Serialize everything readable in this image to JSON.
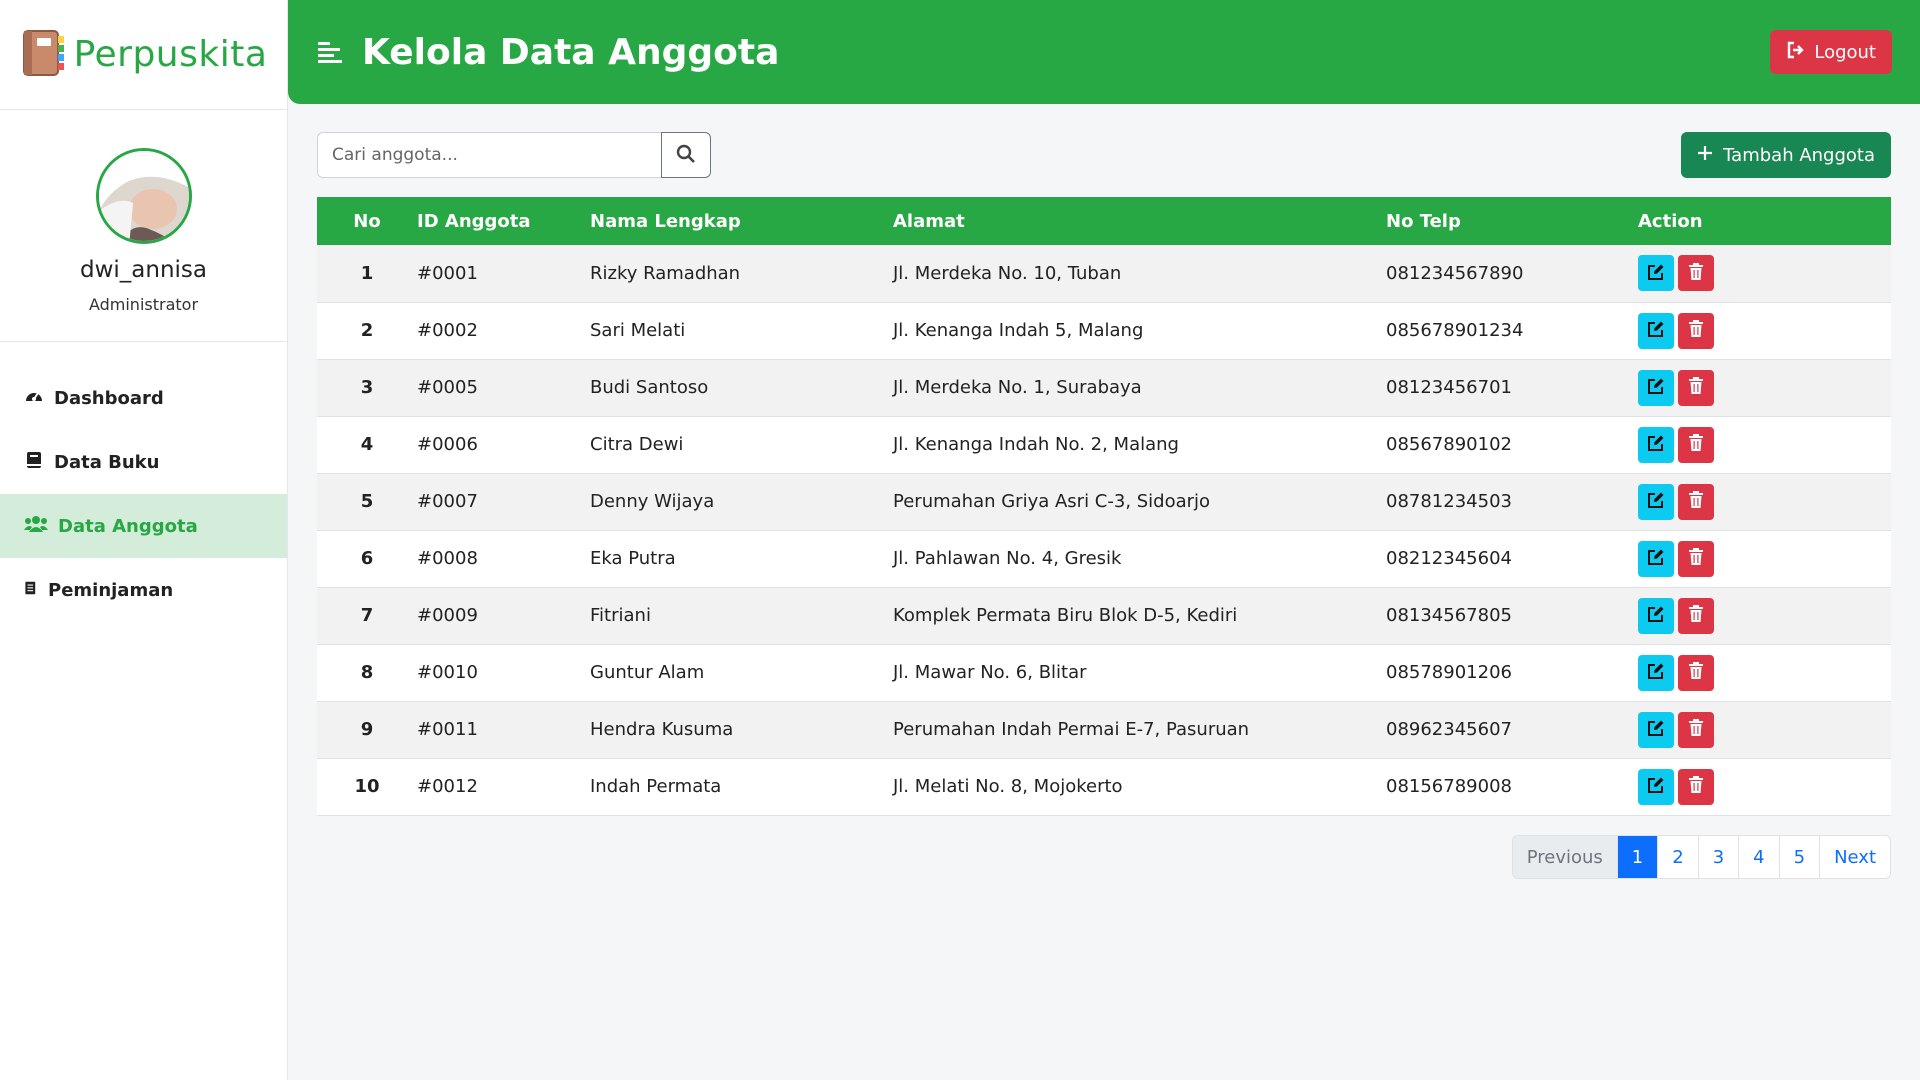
{
  "brand": {
    "name": "Perpuskita"
  },
  "profile": {
    "username": "dwi_annisa",
    "role": "Administrator"
  },
  "sidebar": {
    "items": [
      {
        "label": "Dashboard",
        "icon": "dashboard-icon"
      },
      {
        "label": "Data Buku",
        "icon": "book-icon"
      },
      {
        "label": "Data Anggota",
        "icon": "users-icon",
        "active": true
      },
      {
        "label": "Peminjaman",
        "icon": "list-icon"
      }
    ]
  },
  "header": {
    "title": "Kelola Data Anggota",
    "logout_label": "Logout"
  },
  "toolbar": {
    "search_placeholder": "Cari anggota...",
    "add_label": "Tambah Anggota"
  },
  "table": {
    "columns": [
      "No",
      "ID Anggota",
      "Nama Lengkap",
      "Alamat",
      "No Telp",
      "Action"
    ],
    "rows": [
      [
        "1",
        "#0001",
        "Rizky Ramadhan",
        "Jl. Merdeka No. 10, Tuban",
        "081234567890"
      ],
      [
        "2",
        "#0002",
        "Sari Melati",
        "Jl. Kenanga Indah 5, Malang",
        "085678901234"
      ],
      [
        "3",
        "#0005",
        "Budi Santoso",
        "Jl. Merdeka No. 1, Surabaya",
        "08123456701"
      ],
      [
        "4",
        "#0006",
        "Citra Dewi",
        "Jl. Kenanga Indah No. 2, Malang",
        "08567890102"
      ],
      [
        "5",
        "#0007",
        "Denny Wijaya",
        "Perumahan Griya Asri C-3, Sidoarjo",
        "08781234503"
      ],
      [
        "6",
        "#0008",
        "Eka Putra",
        "Jl. Pahlawan No. 4, Gresik",
        "08212345604"
      ],
      [
        "7",
        "#0009",
        "Fitriani",
        "Komplek Permata Biru Blok D-5, Kediri",
        "08134567805"
      ],
      [
        "8",
        "#0010",
        "Guntur Alam",
        "Jl. Mawar No. 6, Blitar",
        "08578901206"
      ],
      [
        "9",
        "#0011",
        "Hendra Kusuma",
        "Perumahan Indah Permai E-7, Pasuruan",
        "08962345607"
      ],
      [
        "10",
        "#0012",
        "Indah Permata",
        "Jl. Melati No. 8, Mojokerto",
        "08156789008"
      ]
    ]
  },
  "pagination": {
    "previous_label": "Previous",
    "pages": [
      "1",
      "2",
      "3",
      "4",
      "5"
    ],
    "current": "1",
    "next_label": "Next"
  },
  "colors": {
    "primary": "#28a745",
    "danger": "#dc3545",
    "info": "#0dcaf0",
    "link": "#0d6efd",
    "add_button": "#198754"
  }
}
